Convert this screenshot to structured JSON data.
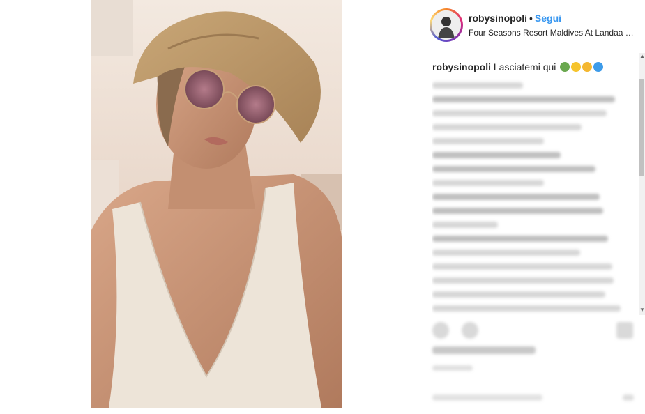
{
  "post": {
    "username": "robysinopoli",
    "separator": "•",
    "follow_label": "Segui",
    "location": "Four Seasons Resort Maldives At Landaa Giraavaru",
    "caption_user": "robysinopoli",
    "caption_text": "Lasciatemi qui",
    "caption_emojis": [
      "palm-tree-icon",
      "sun-icon",
      "sunglasses-face-icon",
      "wave-icon"
    ]
  },
  "colors": {
    "follow": "#3897f0",
    "text": "#262626",
    "divider": "#efefef"
  }
}
